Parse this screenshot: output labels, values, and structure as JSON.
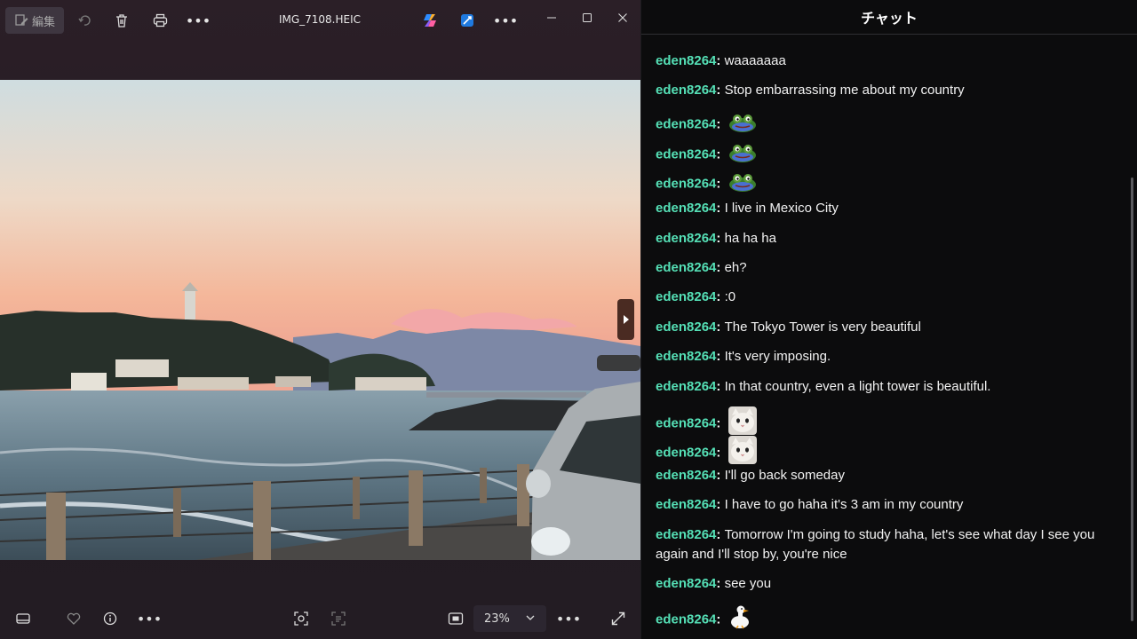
{
  "viewer": {
    "toolbar": {
      "edit_label": "編集",
      "file_name": "IMG_7108.HEIC"
    },
    "zoom": {
      "value": "23%"
    }
  },
  "chat": {
    "title": "チャット",
    "messages": [
      {
        "user": "eden8264",
        "sep": ": ",
        "text": "waaaaaaa"
      },
      {
        "user": "eden8264",
        "sep": ": ",
        "text": "Stop embarrassing me about my country"
      },
      {
        "user": "eden8264",
        "sep": ": ",
        "text": "",
        "emote": "frog-emote"
      },
      {
        "user": "eden8264",
        "sep": ": ",
        "text": "",
        "emote": "frog-emote"
      },
      {
        "user": "eden8264",
        "sep": ": ",
        "text": "",
        "emote": "frog-emote"
      },
      {
        "user": "eden8264",
        "sep": ": ",
        "text": "I live in Mexico City"
      },
      {
        "user": "eden8264",
        "sep": ": ",
        "text": "ha ha ha"
      },
      {
        "user": "eden8264",
        "sep": ": ",
        "text": "eh?"
      },
      {
        "user": "eden8264",
        "sep": ": ",
        "text": ":0"
      },
      {
        "user": "eden8264",
        "sep": ": ",
        "text": "The Tokyo Tower is very beautiful"
      },
      {
        "user": "eden8264",
        "sep": ": ",
        "text": "It's very imposing."
      },
      {
        "user": "eden8264",
        "sep": ": ",
        "text": "In that country, even a light tower is beautiful."
      },
      {
        "user": "eden8264",
        "sep": ": ",
        "text": "",
        "emote": "cat-emote"
      },
      {
        "user": "eden8264",
        "sep": ": ",
        "text": "",
        "emote": "cat-emote"
      },
      {
        "user": "eden8264",
        "sep": ": ",
        "text": "I'll go back someday"
      },
      {
        "user": "eden8264",
        "sep": ": ",
        "text": "I have to go haha it's 3 am in my country"
      },
      {
        "user": "eden8264",
        "sep": ": ",
        "text": "Tomorrow I'm going to study haha, let's see what day I see you again and I'll stop by, you're nice"
      },
      {
        "user": "eden8264",
        "sep": ": ",
        "text": "see you"
      },
      {
        "user": "eden8264",
        "sep": ": ",
        "text": "",
        "emote": "goose-emote"
      }
    ]
  },
  "colors": {
    "username": "#55e0b6",
    "chat_bg": "#0c0c0d",
    "viewer_bg": "#241b23"
  }
}
